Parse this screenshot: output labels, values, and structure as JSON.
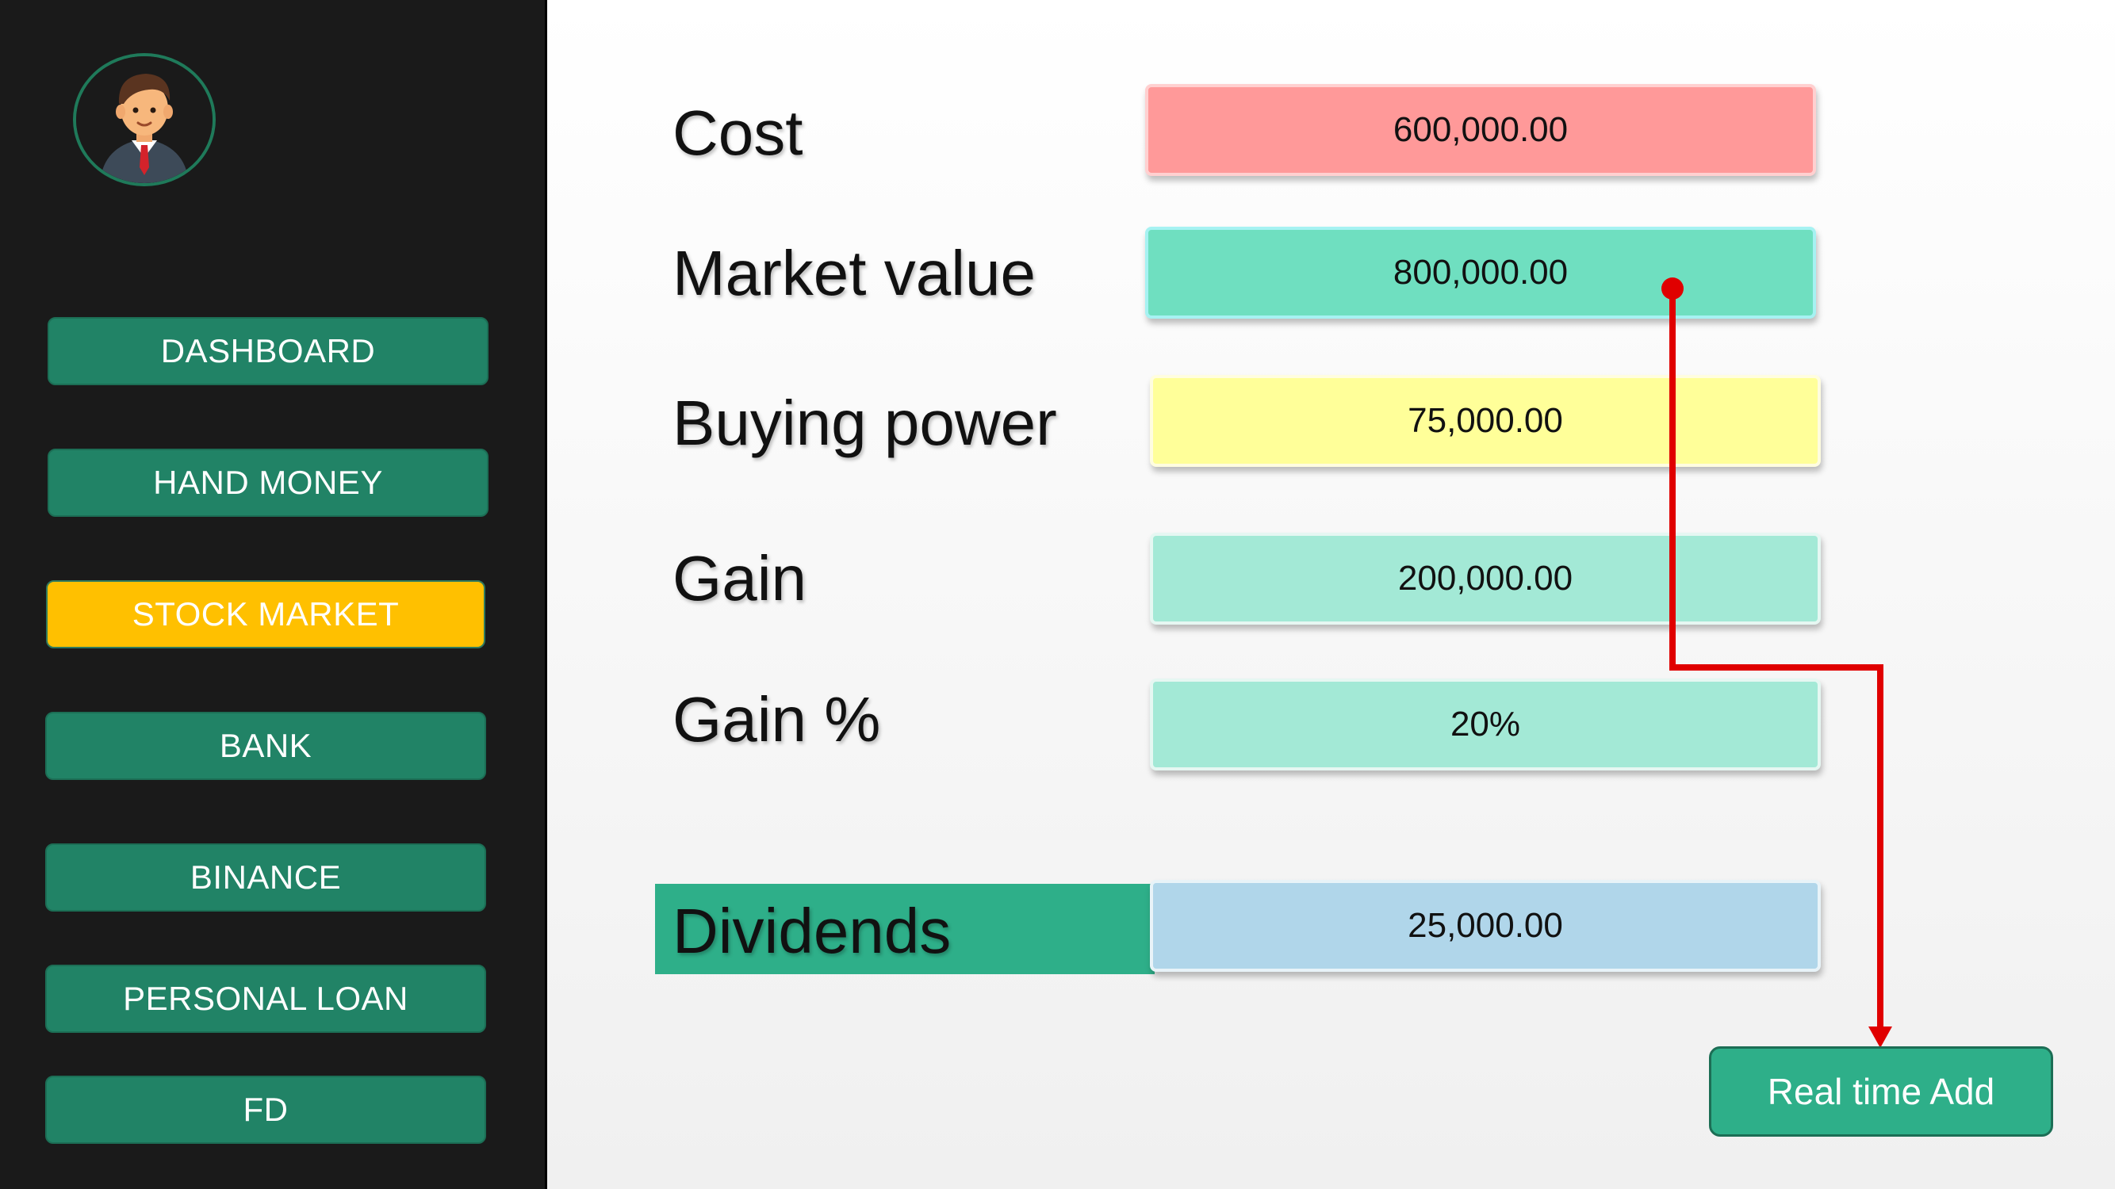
{
  "sidebar": {
    "avatar_icon": "businessman-avatar-icon",
    "items": [
      {
        "label": "DASHBOARD",
        "active": false
      },
      {
        "label": "HAND MONEY",
        "active": false
      },
      {
        "label": "STOCK MARKET",
        "active": true
      },
      {
        "label": "BANK",
        "active": false
      },
      {
        "label": "BINANCE",
        "active": false
      },
      {
        "label": "PERSONAL LOAN",
        "active": false
      },
      {
        "label": "FD",
        "active": false
      }
    ]
  },
  "metrics": {
    "cost": {
      "label": "Cost",
      "value": "600,000.00",
      "color": "#ff9999"
    },
    "market_value": {
      "label": "Market value",
      "value": "800,000.00",
      "color": "#6fdfc0"
    },
    "buying_power": {
      "label": "Buying power",
      "value": "75,000.00",
      "color": "#ffff99"
    },
    "gain": {
      "label": "Gain",
      "value": "200,000.00",
      "color": "#a3e9d6"
    },
    "gain_pct": {
      "label": "Gain %",
      "value": "20%",
      "color": "#a3e9d6"
    },
    "dividends": {
      "label": "Dividends",
      "value": "25,000.00",
      "color": "#b0d6ea"
    }
  },
  "actions": {
    "real_time_add_label": "Real time Add"
  },
  "colors": {
    "sidebar_bg": "#1a1a1a",
    "nav_button": "#218366",
    "nav_active": "#ffc000",
    "accent": "#2eaf89",
    "connector": "#e00000"
  }
}
